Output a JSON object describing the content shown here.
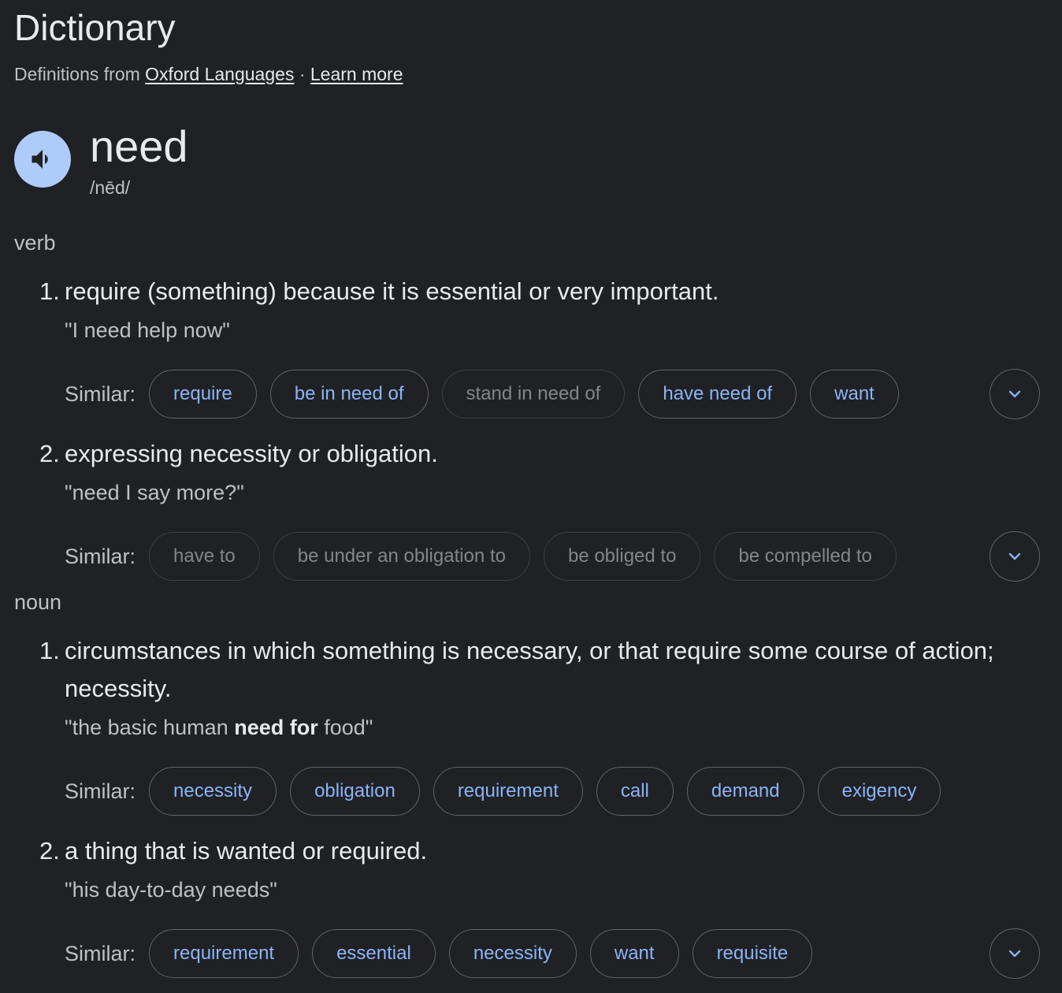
{
  "header": {
    "title": "Dictionary",
    "source_prefix": "Definitions from",
    "source_link": "Oxford Languages",
    "separator": "·",
    "learn_more": "Learn more"
  },
  "entry": {
    "word": "need",
    "phonetic": "/nēd/",
    "speaker_icon": "speaker-icon"
  },
  "verb": {
    "pos": "verb",
    "senses": [
      {
        "num": "1.",
        "definition": "require (something) because it is essential or very important.",
        "example": "\"I need help now\"",
        "similar_label": "Similar:",
        "similar": [
          "require",
          "be in need of",
          "stand in need of",
          "have need of",
          "want"
        ]
      },
      {
        "num": "2.",
        "definition": "expressing necessity or obligation.",
        "example": "\"need I say more?\"",
        "similar_label": "Similar:",
        "similar": [
          "have to",
          "be under an obligation to",
          "be obliged to",
          "be compelled to"
        ]
      }
    ]
  },
  "noun": {
    "pos": "noun",
    "senses": [
      {
        "num": "1.",
        "definition": "circumstances in which something is necessary, or that require some course of action; necessity.",
        "example_pre": "\"the basic human ",
        "example_bold": "need for",
        "example_post": " food\"",
        "similar_label": "Similar:",
        "similar": [
          "necessity",
          "obligation",
          "requirement",
          "call",
          "demand",
          "exigency"
        ]
      },
      {
        "num": "2.",
        "definition": "a thing that is wanted or required.",
        "example": "\"his day-to-day needs\"",
        "similar_label": "Similar:",
        "similar": [
          "requirement",
          "essential",
          "necessity",
          "want",
          "requisite"
        ]
      }
    ]
  },
  "colors": {
    "background": "#202124",
    "link_chip": "#8ab4f8",
    "speaker_bg": "#aecbfa"
  }
}
